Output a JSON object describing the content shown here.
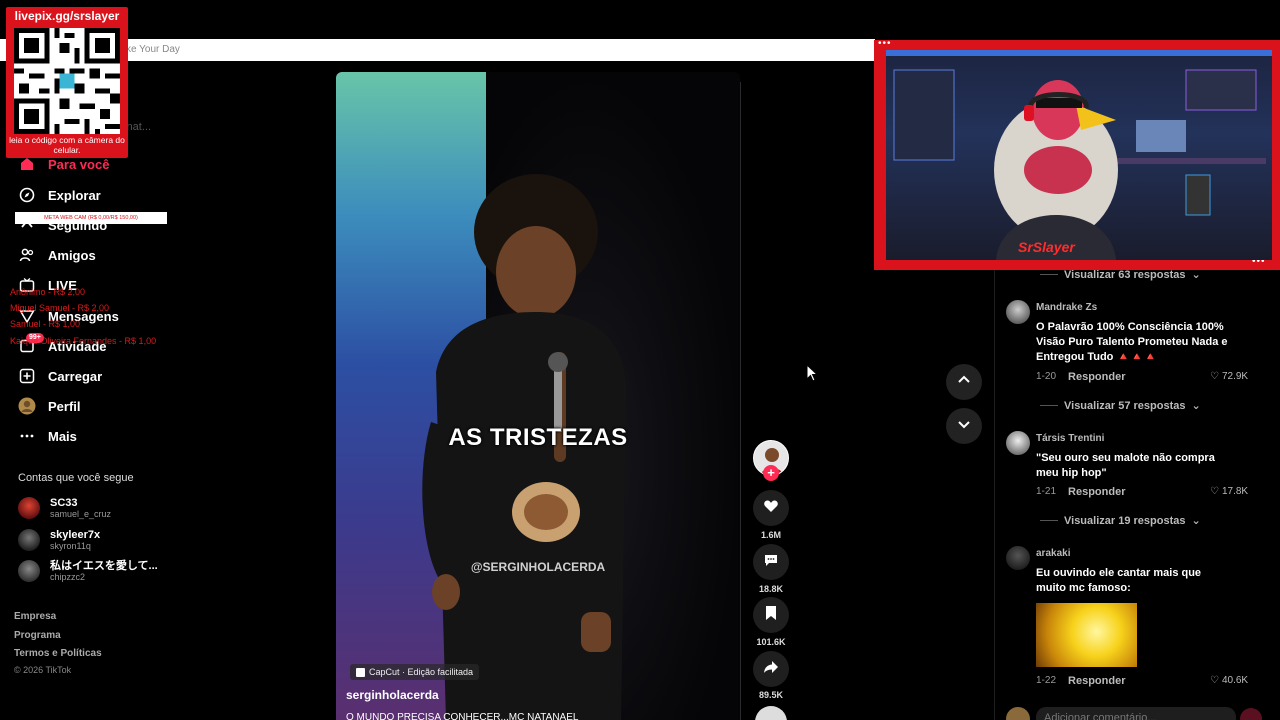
{
  "topbar": {
    "search_text": "ke Your Day"
  },
  "qr_overlay": {
    "link": "livepix.gg/srslayer",
    "hint": "leia o código com a câmera do celular."
  },
  "nav": {
    "search_ghost": "c nat...",
    "items": [
      {
        "label": "Para você",
        "icon": "home-icon"
      },
      {
        "label": "Explorar",
        "icon": "compass-icon"
      },
      {
        "label": "Seguindo",
        "icon": "following-icon"
      },
      {
        "label": "Amigos",
        "icon": "friends-icon"
      },
      {
        "label": "LIVE",
        "icon": "live-icon"
      },
      {
        "label": "Mensagens",
        "icon": "send-icon"
      },
      {
        "label": "Atividade",
        "icon": "bell-icon"
      },
      {
        "label": "Carregar",
        "icon": "plus-square-icon"
      },
      {
        "label": "Perfil",
        "icon": "avatar-icon"
      },
      {
        "label": "Mais",
        "icon": "more-icon"
      }
    ],
    "activity_badge": "99+",
    "meta_bar": "META WEB CAM (R$ 0,00/R$ 150,00)",
    "donations": [
      "Anônimo - R$ 2,00",
      "Miguel Samuel - R$ 2,00",
      "Samuel - R$ 1,00",
      "Kaique Oliveira Fernandes - R$ 1,00"
    ],
    "following_title": "Contas que você segue",
    "accounts": [
      {
        "name": "SC33",
        "handle": "samuel_e_cruz"
      },
      {
        "name": "skyleer7x",
        "handle": "skyron11q"
      },
      {
        "name": "私はイエスを愛して...",
        "handle": "chipzzc2"
      }
    ],
    "footer": [
      "Empresa",
      "Programa",
      "Termos e Políticas"
    ],
    "copyright": "© 2026 TikTok"
  },
  "video": {
    "caption": "AS TRISTEZAS",
    "watermark": "@SERGINHOLACERDA",
    "capcut": "CapCut · Edição facilitada",
    "author": "serginholacerda",
    "description": "O MUNDO PRECISA CONHECER...MC NATANAEL"
  },
  "rail": {
    "likes": "1.6M",
    "comments": "18.8K",
    "saves": "101.6K",
    "shares": "89.5K"
  },
  "cam_overlay": {
    "name": "SrSlayer"
  },
  "comments": {
    "items": [
      {
        "replies": "Visualizar 63 respostas"
      },
      {
        "user": "Mandrake Zs",
        "text": "O Palavrão 100% Consciência 100% Visão Puro Talento Prometeu Nada e Entregou Tudo 🔺🔺🔺",
        "date": "1-20",
        "reply_label": "Responder",
        "likes": "72.9K",
        "replies": "Visualizar 57 respostas"
      },
      {
        "user": "Társis Trentini",
        "text": "\"Seu ouro seu malote não compra meu hip hop\"",
        "date": "1-21",
        "reply_label": "Responder",
        "likes": "17.8K",
        "replies": "Visualizar 19 respostas"
      },
      {
        "user": "arakaki",
        "text": "Eu ouvindo ele cantar mais que muito mc famoso:",
        "date": "1-22",
        "reply_label": "Responder",
        "likes": "40.6K"
      }
    ],
    "input_placeholder": "Adicionar comentário..."
  }
}
